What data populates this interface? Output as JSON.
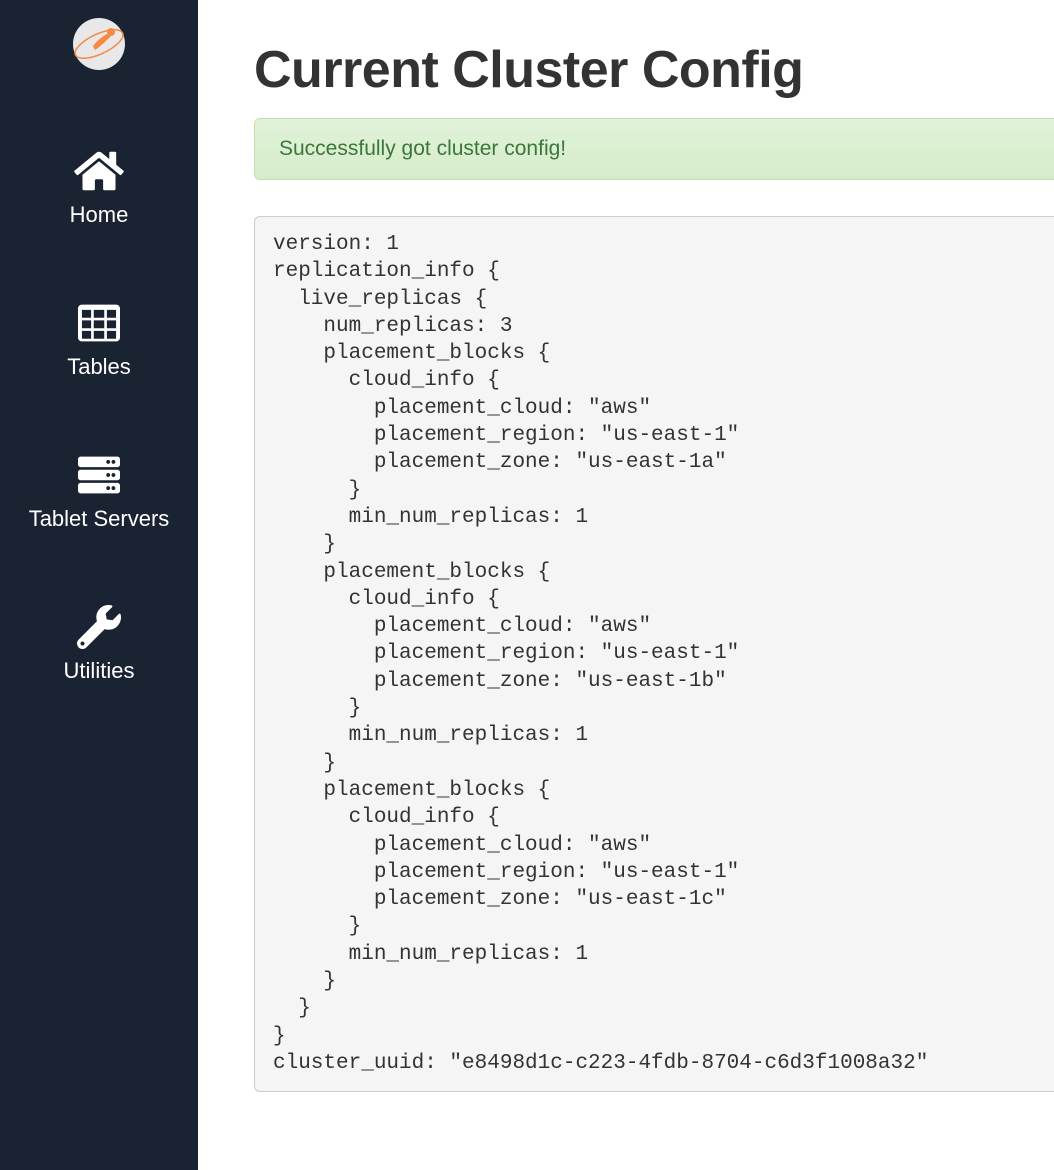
{
  "sidebar": {
    "items": [
      {
        "label": "Home",
        "icon": "home-icon"
      },
      {
        "label": "Tables",
        "icon": "table-icon"
      },
      {
        "label": "Tablet Servers",
        "icon": "server-icon"
      },
      {
        "label": "Utilities",
        "icon": "wrench-icon"
      }
    ]
  },
  "page": {
    "title": "Current Cluster Config",
    "alert_message": "Successfully got cluster config!",
    "config_text": "version: 1\nreplication_info {\n  live_replicas {\n    num_replicas: 3\n    placement_blocks {\n      cloud_info {\n        placement_cloud: \"aws\"\n        placement_region: \"us-east-1\"\n        placement_zone: \"us-east-1a\"\n      }\n      min_num_replicas: 1\n    }\n    placement_blocks {\n      cloud_info {\n        placement_cloud: \"aws\"\n        placement_region: \"us-east-1\"\n        placement_zone: \"us-east-1b\"\n      }\n      min_num_replicas: 1\n    }\n    placement_blocks {\n      cloud_info {\n        placement_cloud: \"aws\"\n        placement_region: \"us-east-1\"\n        placement_zone: \"us-east-1c\"\n      }\n      min_num_replicas: 1\n    }\n  }\n}\ncluster_uuid: \"e8498d1c-c223-4fdb-8704-c6d3f1008a32\""
  },
  "config": {
    "version": 1,
    "replication_info": {
      "live_replicas": {
        "num_replicas": 3,
        "placement_blocks": [
          {
            "cloud_info": {
              "placement_cloud": "aws",
              "placement_region": "us-east-1",
              "placement_zone": "us-east-1a"
            },
            "min_num_replicas": 1
          },
          {
            "cloud_info": {
              "placement_cloud": "aws",
              "placement_region": "us-east-1",
              "placement_zone": "us-east-1b"
            },
            "min_num_replicas": 1
          },
          {
            "cloud_info": {
              "placement_cloud": "aws",
              "placement_region": "us-east-1",
              "placement_zone": "us-east-1c"
            },
            "min_num_replicas": 1
          }
        ]
      }
    },
    "cluster_uuid": "e8498d1c-c223-4fdb-8704-c6d3f1008a32"
  }
}
